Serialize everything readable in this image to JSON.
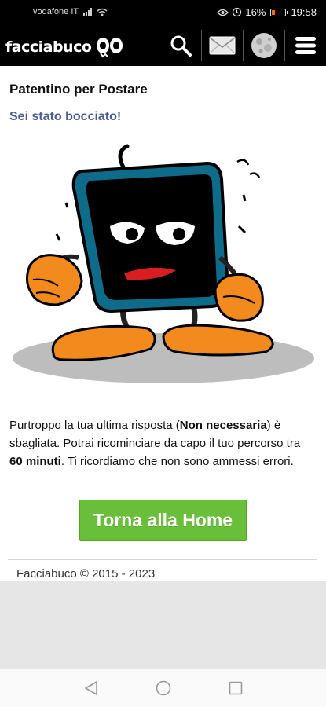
{
  "status_bar": {
    "carrier": "vodafone IT",
    "battery_percent": "16%",
    "time": "19:58",
    "icons": [
      "signal-icon",
      "wifi-icon",
      "eye-icon",
      "alarm-icon",
      "battery-icon"
    ]
  },
  "header": {
    "logo": "facciabuco",
    "icons": [
      "search-icon",
      "mail-icon",
      "moon-icon",
      "menu-icon"
    ]
  },
  "page": {
    "title": "Patentino per Postare",
    "subtitle": "Sei stato bocciato!",
    "message_1": "Purtroppo la tua ultima risposta (",
    "message_answer": "Non necessaria",
    "message_2": ") è sbagliata. Potrai ricominciare da capo il tuo percorso tra ",
    "message_time": "60 minuti",
    "message_3": ". Ti ricordiamo che non sono ammessi errori.",
    "button_label": "Torna alla Home"
  },
  "footer": {
    "text": "Facciabuco © 2015 - 2023"
  },
  "system_nav": {
    "icons": [
      "back-icon",
      "home-icon",
      "recents-icon"
    ]
  },
  "colors": {
    "header_bg": "#000000",
    "subtitle": "#4a5a9a",
    "button_bg": "#6abf3a",
    "grey_area": "#e6e6e6"
  }
}
